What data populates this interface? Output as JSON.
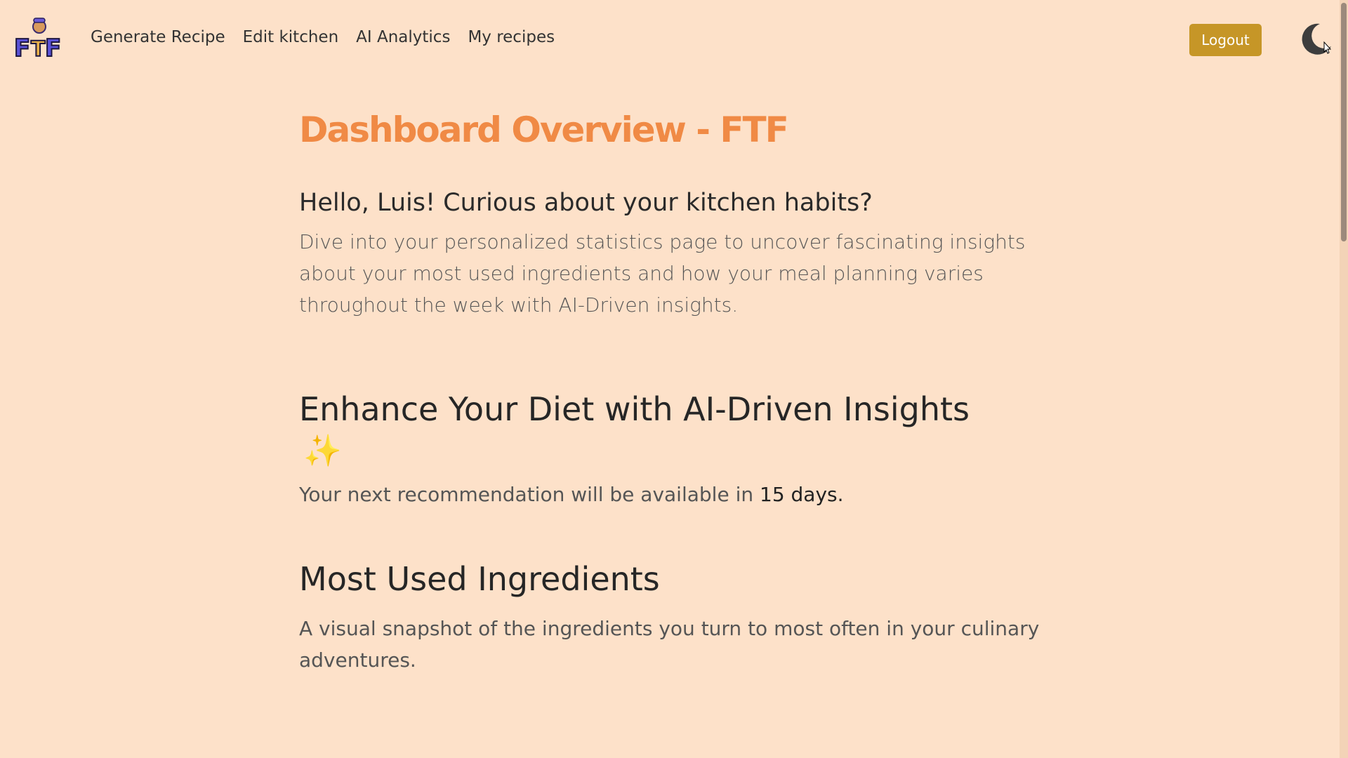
{
  "navbar": {
    "logo_alt": "FTF",
    "links": [
      "Generate Recipe",
      "Edit kitchen",
      "AI Analytics",
      "My recipes"
    ],
    "logout_label": "Logout",
    "theme_icon": "moon-icon"
  },
  "main": {
    "title": "Dashboard Overview - FTF",
    "greeting": "Hello, Luis! Curious about your kitchen habits?",
    "intro": "Dive into your personalized statistics page to uncover fascinating insights about your most used ingredients and how your meal planning varies throughout the week with AI-Driven insights.",
    "ai_section": {
      "heading": "Enhance Your Diet with AI-Driven Insights",
      "sparkle": "✨",
      "recommendation_prefix": "Your next recommendation will be available in ",
      "recommendation_days": "15 days."
    },
    "ingredients_section": {
      "heading": "Most Used Ingredients",
      "description": "A visual snapshot of the ingredients you turn to most often in your culinary adventures."
    }
  },
  "colors": {
    "background": "#fde1c9",
    "title": "#f08a45",
    "logout_button": "#c69627"
  }
}
